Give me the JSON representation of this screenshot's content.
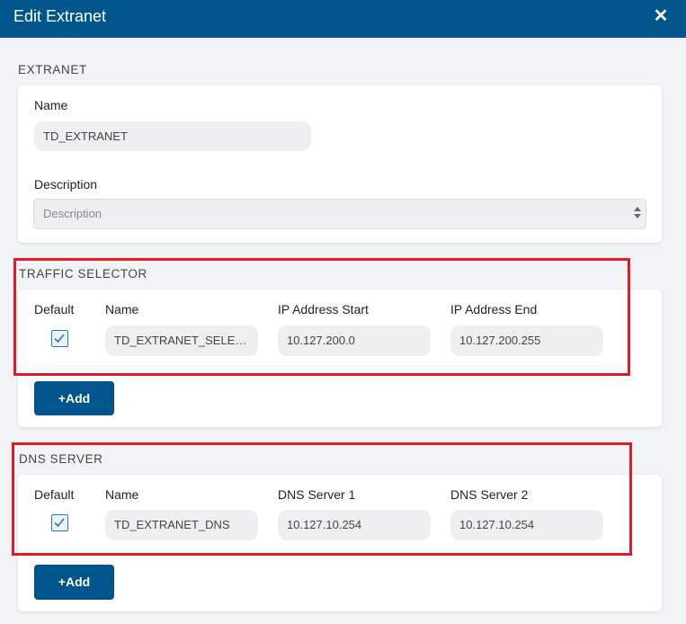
{
  "dialog": {
    "title": "Edit Extranet",
    "close_glyph": "✕"
  },
  "extranet": {
    "section_title": "EXTRANET",
    "name_label": "Name",
    "name_value": "TD_EXTRANET",
    "description_label": "Description",
    "description_placeholder": "Description"
  },
  "traffic_selector": {
    "section_title": "TRAFFIC SELECTOR",
    "columns": [
      "Default",
      "Name",
      "IP Address Start",
      "IP Address End"
    ],
    "row": {
      "default_checked": true,
      "name": "TD_EXTRANET_SELECTOR",
      "ip_start": "10.127.200.0",
      "ip_end": "10.127.200.255"
    },
    "add_label": "+Add"
  },
  "dns_server": {
    "section_title": "DNS SERVER",
    "columns": [
      "Default",
      "Name",
      "DNS Server 1",
      "DNS Server 2"
    ],
    "row": {
      "default_checked": true,
      "name": "TD_EXTRANET_DNS",
      "dns1": "10.127.10.254",
      "dns2": "10.127.10.254"
    },
    "add_label": "+Add"
  },
  "colors": {
    "header": "#00558c",
    "button": "#00558c",
    "highlight": "#e21b2a"
  }
}
